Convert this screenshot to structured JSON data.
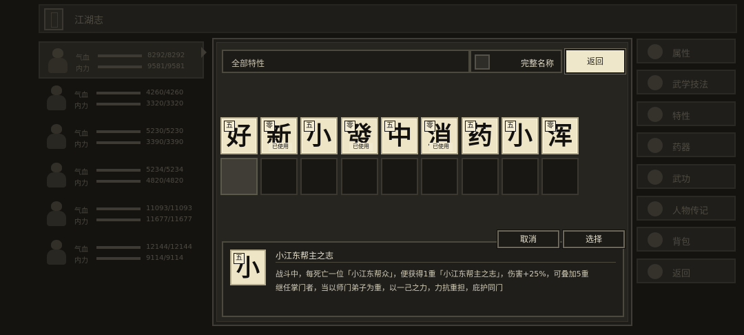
{
  "header": {
    "title": "江湖志"
  },
  "party": [
    {
      "hp_label": "气血",
      "mp_label": "内力",
      "hp": "8292/8292",
      "mp": "9581/9581",
      "active": true
    },
    {
      "hp_label": "气血",
      "mp_label": "内力",
      "hp": "4260/4260",
      "mp": "3320/3320",
      "active": false
    },
    {
      "hp_label": "气血",
      "mp_label": "内力",
      "hp": "5230/5230",
      "mp": "3390/3390",
      "active": false
    },
    {
      "hp_label": "气血",
      "mp_label": "内力",
      "hp": "5234/5234",
      "mp": "4820/4820",
      "active": false
    },
    {
      "hp_label": "气血",
      "mp_label": "内力",
      "hp": "11093/11093",
      "mp": "11677/11677",
      "active": false
    },
    {
      "hp_label": "气血",
      "mp_label": "内力",
      "hp": "12144/12144",
      "mp": "9114/9114",
      "active": false
    }
  ],
  "sidebar": {
    "items": [
      {
        "label": "属性",
        "icon": "avatar-icon"
      },
      {
        "label": "武学技法",
        "icon": "avatar-icon"
      },
      {
        "label": "特性",
        "icon": "avatar-icon"
      },
      {
        "label": "药器",
        "icon": "wand-icon"
      },
      {
        "label": "武功",
        "icon": "scroll-icon"
      },
      {
        "label": "人物传记",
        "icon": "person-icon"
      },
      {
        "label": "背包",
        "icon": "bag-icon"
      },
      {
        "label": "返回",
        "icon": "door-icon"
      }
    ]
  },
  "modal": {
    "search_text": "全部特性",
    "full_name_label": "完整名称",
    "full_name_checked": false,
    "back_label": "返回",
    "tiles": [
      {
        "char": "好",
        "grade": "五",
        "used": ""
      },
      {
        "char": "新",
        "grade": "零",
        "used": "已使用"
      },
      {
        "char": "小",
        "grade": "五",
        "used": ""
      },
      {
        "char": "發",
        "grade": "零",
        "used": "已使用"
      },
      {
        "char": "中",
        "grade": "五",
        "used": ""
      },
      {
        "char": "消",
        "grade": "零",
        "used": "已使用"
      },
      {
        "char": "药",
        "grade": "五",
        "used": ""
      },
      {
        "char": "小",
        "grade": "五",
        "used": ""
      },
      {
        "char": "浑",
        "grade": "零",
        "used": ""
      }
    ],
    "cancel_label": "取消",
    "select_label": "选择",
    "detail": {
      "char": "小",
      "grade": "五",
      "name": "小江东帮主之志",
      "desc_line1": "战斗中，每死亡一位「小江东帮众」，便获得1重「小江东帮主之志」，伤害+25%，可叠加5重",
      "desc_line2": "继任掌门者，当以师门弟子为重，以一己之力，力抗重担，庇护同门"
    }
  }
}
